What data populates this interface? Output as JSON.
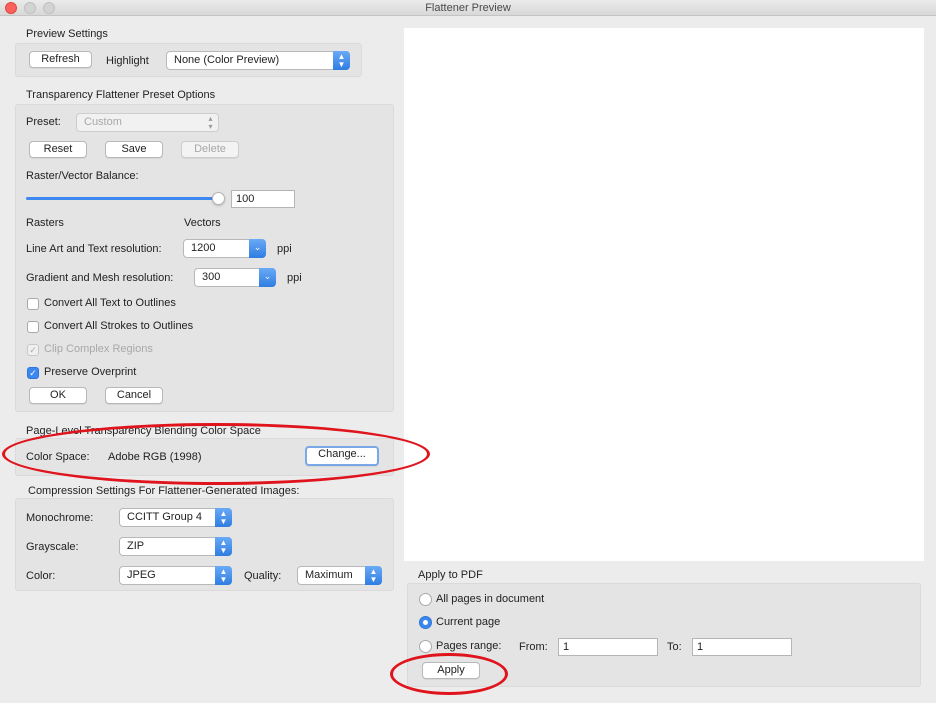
{
  "window": {
    "title": "Flattener Preview"
  },
  "preview_settings": {
    "title": "Preview Settings",
    "refresh_label": "Refresh",
    "highlight_label": "Highlight",
    "highlight_value": "None (Color Preview)"
  },
  "preset_options": {
    "title": "Transparency Flattener Preset Options",
    "preset_label": "Preset:",
    "preset_value": "Custom",
    "reset_label": "Reset",
    "save_label": "Save",
    "delete_label": "Delete",
    "balance_label": "Raster/Vector Balance:",
    "balance_value": "100",
    "balance_level": 1.0,
    "rasters_label": "Rasters",
    "vectors_label": "Vectors",
    "line_art_label": "Line Art and Text resolution:",
    "line_art_value": "1200",
    "gradient_label": "Gradient and Mesh resolution:",
    "gradient_value": "300",
    "ppi": "ppi",
    "convert_text_label": "Convert All Text to Outlines",
    "convert_strokes_label": "Convert All Strokes to Outlines",
    "clip_complex_label": "Clip Complex Regions",
    "preserve_overprint_label": "Preserve Overprint",
    "ok_label": "OK",
    "cancel_label": "Cancel"
  },
  "blending": {
    "title": "Page-Level Transparency Blending Color Space",
    "color_space_label": "Color Space:",
    "color_space_value": "Adobe RGB (1998)",
    "change_label": "Change..."
  },
  "compression": {
    "title": "Compression Settings For Flattener-Generated Images:",
    "monochrome_label": "Monochrome:",
    "monochrome_value": "CCITT Group 4",
    "grayscale_label": "Grayscale:",
    "grayscale_value": "ZIP",
    "color_label": "Color:",
    "color_value": "JPEG",
    "quality_label": "Quality:",
    "quality_value": "Maximum"
  },
  "apply_pdf": {
    "title": "Apply to PDF",
    "all_pages_label": "All pages in document",
    "current_page_label": "Current page",
    "pages_range_label": "Pages range:",
    "from_label": "From:",
    "from_value": "1",
    "to_label": "To:",
    "to_value": "1",
    "apply_label": "Apply"
  },
  "colors": {
    "accent": "#3d88f0",
    "annotation": "#e0141c",
    "window_bg": "#ececec"
  }
}
